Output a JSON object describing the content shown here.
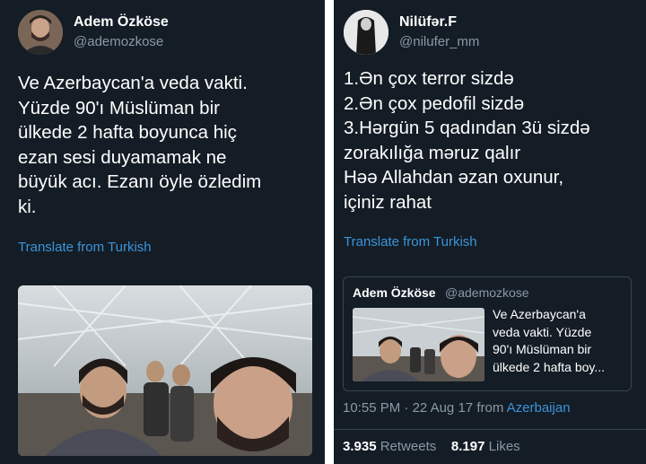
{
  "left_tweet": {
    "name": "Adem Özköse",
    "handle": "@ademozkose",
    "text": "Ve Azerbaycan'a veda vakti.\nYüzde 90'ı Müslüman bir\nülkede 2 hafta boyunca hiç\nezan sesi duyamamak ne\nbüyük acı. Ezanı öyle özledim\nki.",
    "translate_link": "Translate from Turkish"
  },
  "right_tweet": {
    "name": "Nilüfər.F",
    "handle": "@nilufer_mm",
    "text": "1.Ən çox terror sizdə\n2.Ən çox pedofil sizdə\n3.Hərgün 5 qadından 3ü sizdə\nzorakılığa məruz qalır\nHəə Allahdan əzan oxunur,\niçiniz rahat",
    "translate_link": "Translate from Turkish",
    "quoted": {
      "name": "Adem Özköse",
      "handle": "@ademozkose",
      "text": "Ve Azerbaycan'a\nveda vakti. Yüzde\n90'ı Müslüman bir\nülkede 2 hafta boy..."
    },
    "meta": {
      "time": "10:55 PM",
      "separator": " · ",
      "date": "22 Aug 17",
      "from_label": "from",
      "location": "Azerbaijan"
    },
    "stats": {
      "retweets_count": "3.935",
      "retweets_label": "Retweets",
      "likes_count": "8.197",
      "likes_label": "Likes"
    }
  },
  "colors": {
    "background": "#141d26",
    "text": "#ffffff",
    "secondary": "#8899a6",
    "link": "#3b94d9",
    "border": "#38444d"
  }
}
